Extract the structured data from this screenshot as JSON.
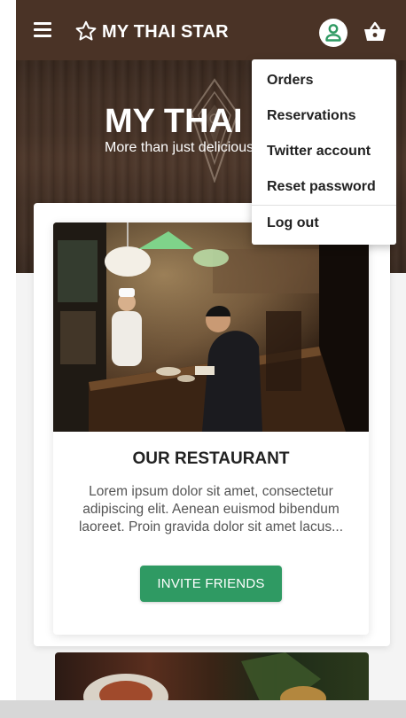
{
  "toolbar": {
    "brand": "MY THAI STAR",
    "menu_icon": "menu-icon",
    "star_icon": "star-outline-icon",
    "user_icon": "person-icon",
    "cart_icon": "shopping-basket-icon",
    "color": "#4a3326"
  },
  "hero": {
    "title": "MY THAI STAR",
    "subtitle": "More than just delicious"
  },
  "restaurant_card": {
    "title": "OUR RESTAURANT",
    "text": "Lorem ipsum dolor sit amet, consectetur adipiscing elit. Aenean euismod bibendum laoreet. Proin gravida dolor sit amet lacus...",
    "button": "INVITE FRIENDS",
    "button_color": "#2f9a63"
  },
  "user_menu": {
    "items": [
      "Orders",
      "Reservations",
      "Twitter account",
      "Reset password"
    ],
    "logout": "Log out"
  }
}
